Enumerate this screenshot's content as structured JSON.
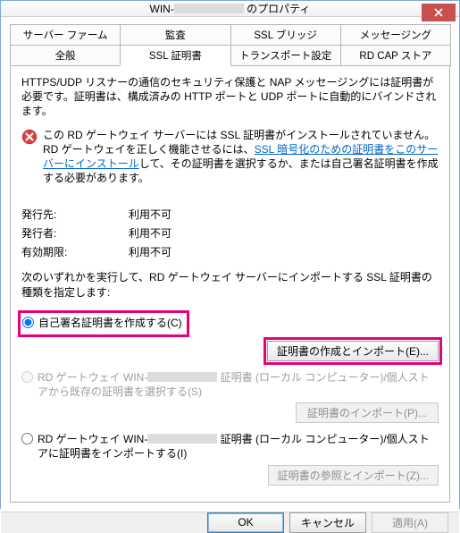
{
  "title_prefix": "WIN-",
  "title_suffix": " のプロパティ",
  "tabs_row1": [
    {
      "label": "サーバー ファーム"
    },
    {
      "label": "監査"
    },
    {
      "label": "SSL ブリッジ"
    },
    {
      "label": "メッセージング"
    }
  ],
  "tabs_row2": [
    {
      "label": "全般"
    },
    {
      "label": "SSL 証明書",
      "active": true
    },
    {
      "label": "トランスポート設定"
    },
    {
      "label": "RD CAP ストア"
    }
  ],
  "intro": "HTTPS/UDP リスナーの通信のセキュリティ保護と NAP メッセージングには証明書が必要です。証明書は、構成済みの HTTP ポートと UDP ポートに自動的にバインドされます。",
  "warning_pre": "この RD ゲートウェイ サーバーには SSL 証明書がインストールされていません。RD ゲートウェイを正しく機能させるには、",
  "warning_link": "SSL 暗号化のための証明書をこのサーバーにインストール",
  "warning_post": "して、その証明書を選択するか、または自己署名証明書を作成する必要があります。",
  "issued_to_label": "発行先:",
  "issued_to_value": "利用不可",
  "issued_by_label": "発行者:",
  "issued_by_value": "利用不可",
  "expiry_label": "有効期限:",
  "expiry_value": "利用不可",
  "choose_intro": "次のいずれかを実行して、RD ゲートウェイ サーバーにインポートする SSL 証明書の種類を指定します:",
  "radio1_label": "自己署名証明書を作成する(C)",
  "btn_create": "証明書の作成とインポート(E)...",
  "radio2_pre": "RD ゲートウェイ WIN-",
  "radio2_post": " 証明書 (ローカル コンピューター)/個人ストアから既存の証明書を選択する(S)",
  "btn_import_cert": "証明書のインポート(P)...",
  "radio3_pre": "RD ゲートウェイ WIN-",
  "radio3_post": " 証明書 (ローカル コンピューター)/個人ストアに証明書をインポートする(I)",
  "btn_browse_import": "証明書の参照とインポート(Z)...",
  "footer_ok": "OK",
  "footer_cancel": "キャンセル",
  "footer_apply": "適用(A)"
}
